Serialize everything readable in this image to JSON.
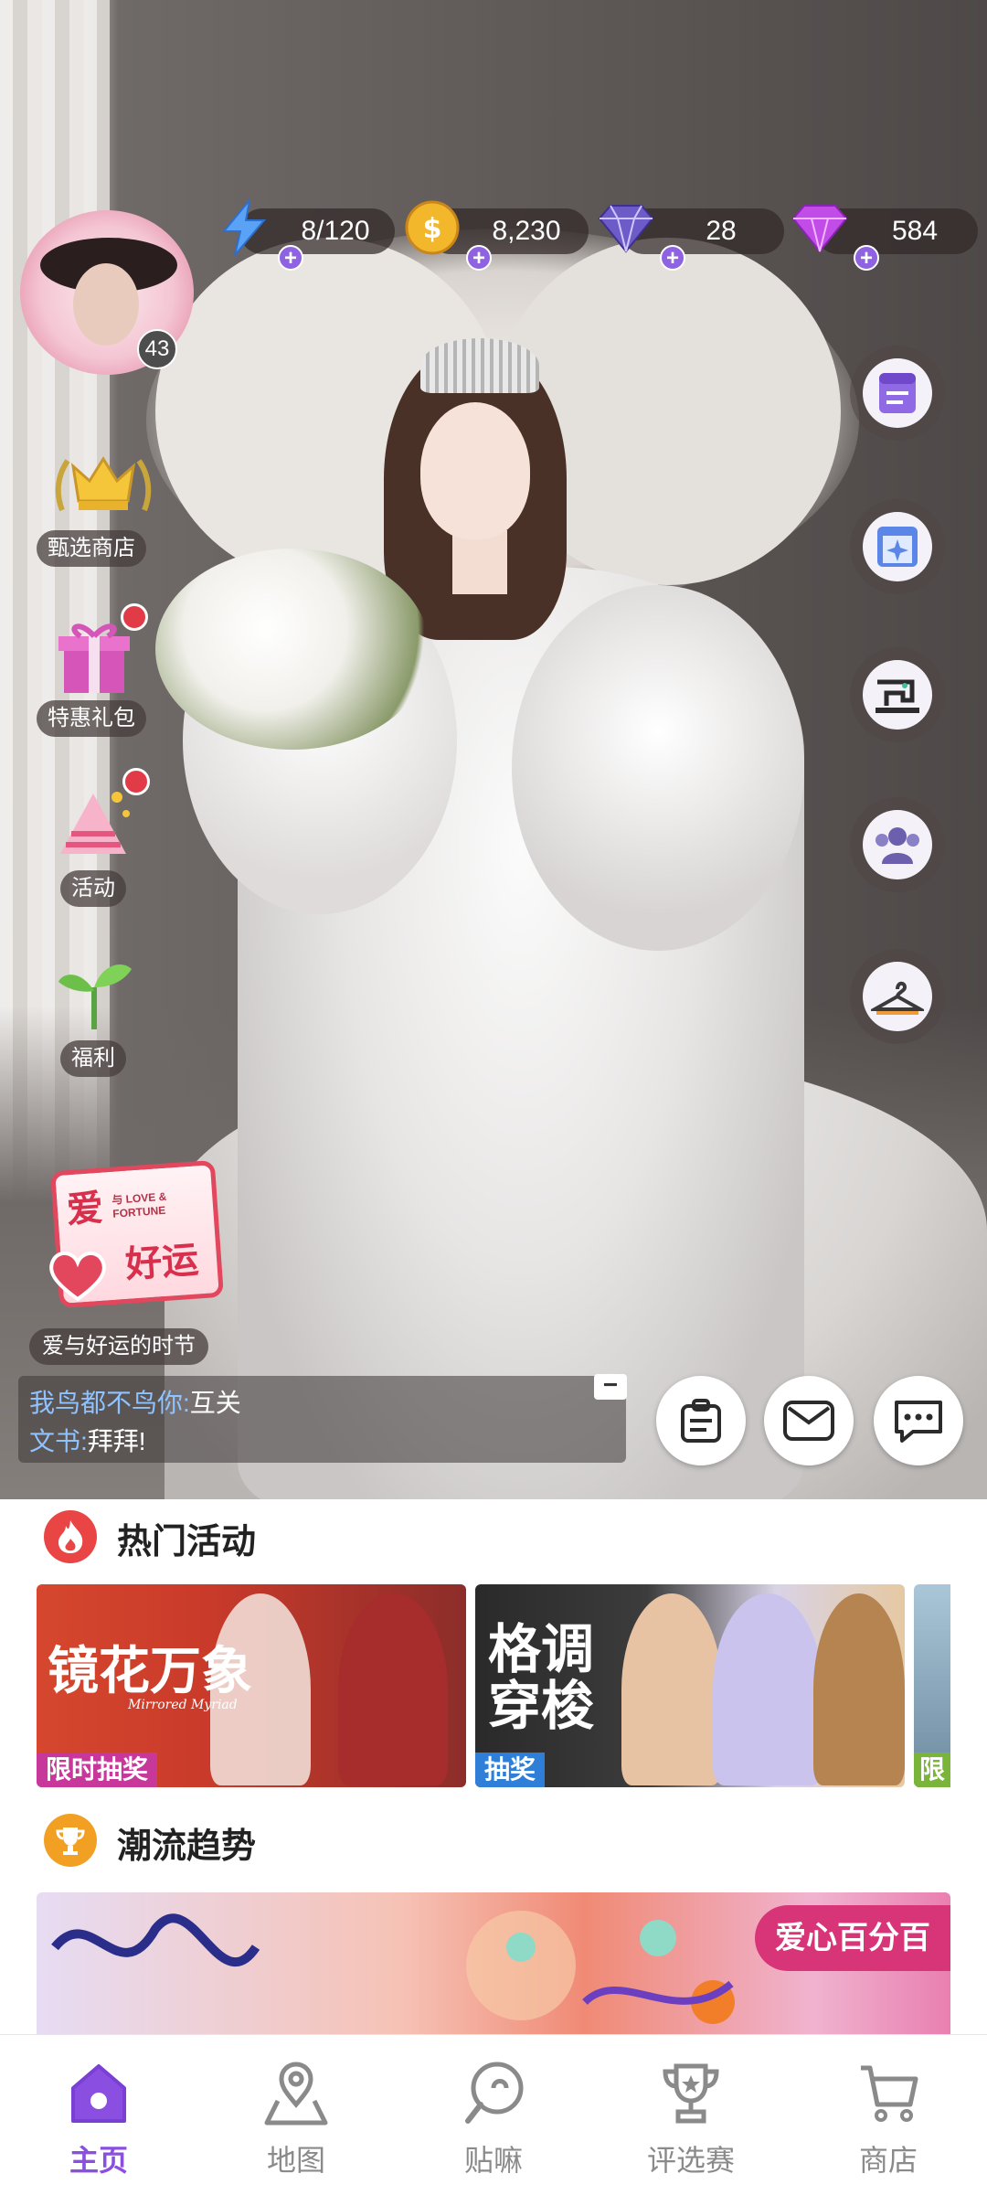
{
  "currencies": {
    "energy": {
      "value": "8/120",
      "icon": "lightning-icon"
    },
    "coins": {
      "value": "8,230",
      "icon": "gold-coin-icon"
    },
    "diamond": {
      "value": "28",
      "icon": "diamond-icon"
    },
    "gem": {
      "value": "584",
      "icon": "purple-gem-icon"
    }
  },
  "player": {
    "level": "43"
  },
  "left_menu": [
    {
      "label": "甄选商店",
      "icon": "crown-icon"
    },
    {
      "label": "特惠礼包",
      "icon": "gift-box-icon"
    },
    {
      "label": "活动",
      "icon": "party-hat-icon"
    },
    {
      "label": "福利",
      "icon": "sprout-icon"
    }
  ],
  "right_menu": [
    "notepad-icon",
    "sparkle-book-icon",
    "sewing-machine-icon",
    "friends-icon",
    "hanger-icon"
  ],
  "festival": {
    "badge_top": "爱",
    "badge_small": "与 LOVE & FORTUNE",
    "badge_main": "好运",
    "label": "爱与好运的时节"
  },
  "chat": {
    "messages": [
      {
        "name": "我鸟都不鸟你:",
        "text": "互关"
      },
      {
        "name": "文书:",
        "text": "拜拜!"
      }
    ],
    "minimize": "−"
  },
  "sections": {
    "hot_events": "热门活动",
    "trends": "潮流趋势"
  },
  "banners": [
    {
      "title": "镜花万象",
      "subtitle": "Mirrored Myriad",
      "tag": "限时抽奖",
      "tag_color": "#c8379a"
    },
    {
      "title": "格调穿梭",
      "tag": "抽奖",
      "tag_color": "#2f7fd8"
    },
    {
      "tag": "限",
      "tag_color": "#7bb43a"
    }
  ],
  "trend_banner": {
    "tag": "爱心百分百"
  },
  "nav": [
    {
      "label": "主页",
      "icon": "home-icon",
      "active": true
    },
    {
      "label": "地图",
      "icon": "map-pin-icon",
      "active": false
    },
    {
      "label": "贴嘛",
      "icon": "lollipop-icon",
      "active": false
    },
    {
      "label": "评选赛",
      "icon": "trophy-icon",
      "active": false
    },
    {
      "label": "商店",
      "icon": "shopping-cart-icon",
      "active": false
    }
  ],
  "colors": {
    "accent": "#8a4ee0",
    "hot_red": "#e94545",
    "trend_orange": "#f2a024"
  }
}
